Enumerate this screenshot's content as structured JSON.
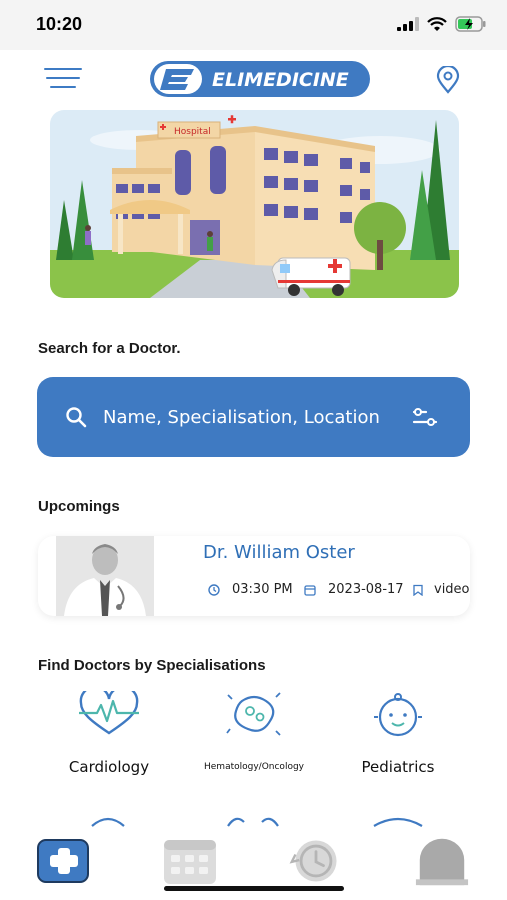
{
  "status": {
    "time": "10:20"
  },
  "header": {
    "logo_text": "ELIMEDICINE",
    "hospital_sign": "Hospital"
  },
  "search": {
    "title": "Search for a Doctor.",
    "placeholder": "Name, Specialisation, Location"
  },
  "upcomings": {
    "title": "Upcomings",
    "appointment": {
      "doctor": "Dr. William Oster",
      "time": "03:30 PM",
      "date": "2023-08-17",
      "type": "video"
    }
  },
  "specialisations": {
    "title": "Find Doctors by Specialisations",
    "items": [
      {
        "label": "Cardiology",
        "icon": "heart-pulse-icon"
      },
      {
        "label": "Hematology/Oncology",
        "icon": "cells-icon"
      },
      {
        "label": "Pediatrics",
        "icon": "baby-face-icon"
      }
    ]
  },
  "tabs": [
    {
      "icon": "medical-cross-icon",
      "active": true
    },
    {
      "icon": "calendar-icon",
      "active": false
    },
    {
      "icon": "history-clock-icon",
      "active": false
    },
    {
      "icon": "profile-icon",
      "active": false
    }
  ],
  "colors": {
    "primary": "#3f7ac2",
    "doctor_name": "#2f6fb6"
  }
}
